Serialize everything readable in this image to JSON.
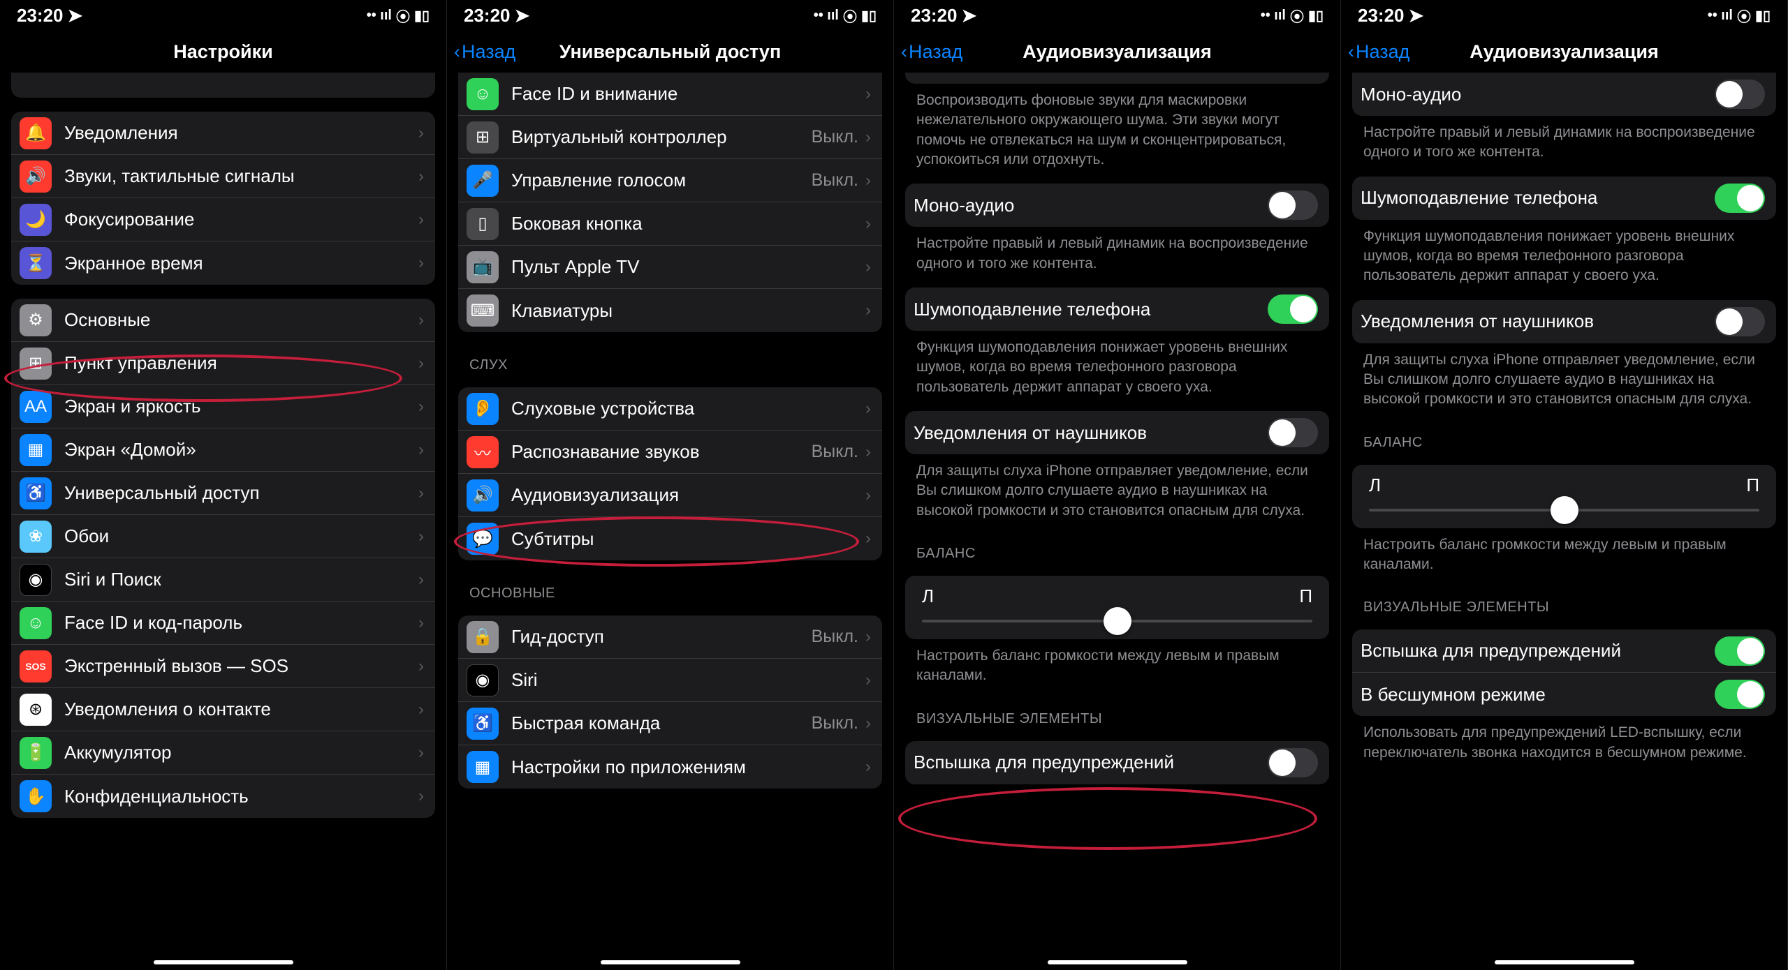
{
  "status": {
    "time": "23:20",
    "location_icon": "➤",
    "signal": "••ıl",
    "wifi": "◉",
    "battery": "▮▯"
  },
  "nav": {
    "back": "Назад",
    "s1_title": "Настройки",
    "s2_title": "Универсальный доступ",
    "s3_title": "Аудиовизуализация",
    "s4_title": "Аудиовизуализация"
  },
  "s1": {
    "notifications": "Уведомления",
    "sounds": "Звуки, тактильные сигналы",
    "focus": "Фокусирование",
    "screentime": "Экранное время",
    "general": "Основные",
    "control": "Пункт управления",
    "display": "Экран и яркость",
    "home": "Экран «Домой»",
    "accessibility": "Универсальный доступ",
    "wallpaper": "Обои",
    "siri": "Siri и Поиск",
    "faceid": "Face ID и код-пароль",
    "sos": "Экстренный вызов — SOS",
    "exposure": "Уведомления о контакте",
    "battery": "Аккумулятор",
    "privacy": "Конфиденциальность"
  },
  "s2": {
    "faceid": "Face ID и внимание",
    "switch": "Виртуальный контроллер",
    "voice": "Управление голосом",
    "side": "Боковая кнопка",
    "appletv": "Пульт Apple TV",
    "keyboards": "Клавиатуры",
    "hearing_header": "СЛУХ",
    "hearing_devices": "Слуховые устройства",
    "sound_rec": "Распознавание звуков",
    "audiovisual": "Аудиовизуализация",
    "subtitles": "Субтитры",
    "general_header": "ОСНОВНЫЕ",
    "guided": "Гид-доступ",
    "siri": "Siri",
    "shortcut": "Быстрая команда",
    "perapp": "Настройки по приложениям",
    "off": "Выкл."
  },
  "s3": {
    "bg_desc": "Воспроизводить фоновые звуки для маскировки нежелательного окружающего шума. Эти звуки могут помочь не отвлекаться на шум и сконцентрироваться, успокоиться или отдохнуть.",
    "mono": "Моно-аудио",
    "mono_desc": "Настройте правый и левый динамик на воспроизведение одного и того же контента.",
    "noise": "Шумоподавление телефона",
    "noise_desc": "Функция шумоподавления понижает уровень внешних шумов, когда во время телефонного разговора пользователь держит аппарат у своего уха.",
    "headphone": "Уведомления от наушников",
    "headphone_desc": "Для защиты слуха iPhone отправляет уведомление, если Вы слишком долго слушаете аудио в наушниках на высокой громкости и это становится опасным для слуха.",
    "balance_header": "БАЛАНС",
    "balance_l": "Л",
    "balance_r": "П",
    "balance_desc": "Настроить баланс громкости между левым и правым каналами.",
    "visual_header": "ВИЗУАЛЬНЫЕ ЭЛЕМЕНТЫ",
    "flash": "Вспышка для предупреждений",
    "silent": "В бесшумном режиме",
    "flash_desc": "Использовать для предупреждений LED-вспышку, если переключатель звонка находится в бесшумном режиме."
  }
}
